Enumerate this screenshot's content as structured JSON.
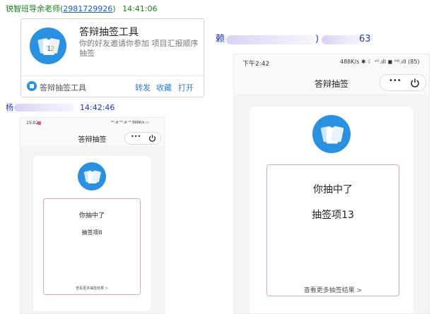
{
  "chat": {
    "message1": {
      "sender": "锐智班导余老师(",
      "sender_id": "2981729926",
      "sender_close": ")",
      "time": "14:41:06"
    },
    "card": {
      "title": "答辩抽签工具",
      "description": "你的好友邀请你参加 项目汇报顺序 抽签",
      "app_name": "答辩抽签工具",
      "actions": [
        "转发",
        "收藏",
        "打开"
      ]
    },
    "message2": {
      "sender_prefix": "赖",
      "sender_suffix": "63"
    },
    "message3": {
      "sender_prefix": "杨",
      "time": "14:42:46"
    }
  },
  "phone_large": {
    "status_time": "下午2:42",
    "status_right": "488K/s ✱ ☾ ˢᴳ.ıll ◼ ᴴᴰ.ıll (85)",
    "title": "答辩抽签",
    "more_label": "•••",
    "result_heading": "你抽中了",
    "result_item": "抽签项13",
    "more_link": "查看更多抽签结果 >"
  },
  "phone_small": {
    "status_time": "15:02",
    "status_right": "ᴴᴰ.ıll ᴴᴰ.ıll ˢᴳ 999K/s ▭",
    "title": "答辩抽签",
    "more_label": "•••",
    "result_heading": "你抽中了",
    "result_item": "抽签项8",
    "more_link": "查看更多抽签结果 >"
  },
  "logo": {
    "card_left": "1",
    "card_right": "2"
  },
  "colors": {
    "sender_green": "#1a7f1a",
    "sender_blue": "#1a39c8",
    "link_blue": "#2b7ad9",
    "logo_blue": "#2a90e0",
    "result_border": "#e9a6a6"
  }
}
